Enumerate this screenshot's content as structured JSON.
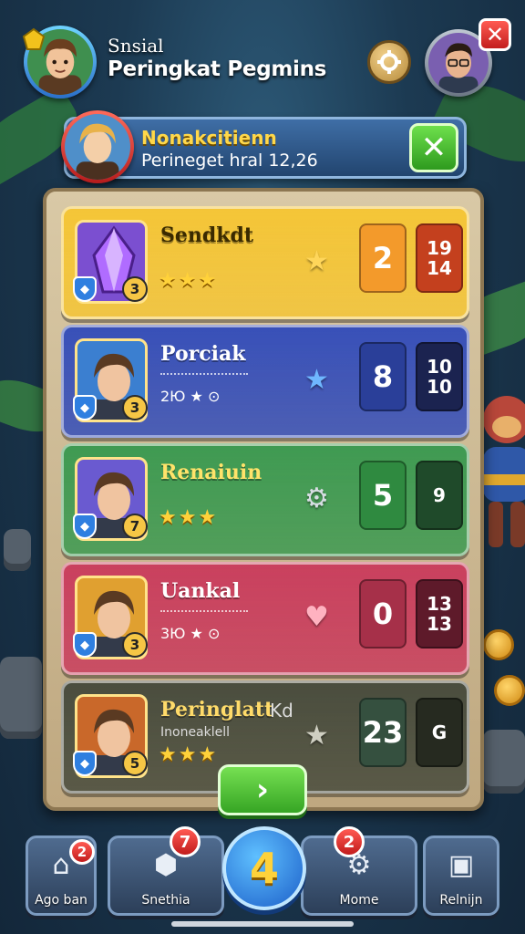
{
  "header": {
    "title_small": "Snsial",
    "title_big": "Peringkat Pegmins"
  },
  "player": {
    "name": "Nonakcitienn",
    "subtitle": "Perineget hral 12,26"
  },
  "rows": [
    {
      "name": "Sendkdt",
      "level": "3",
      "stars": "★★★",
      "score": "",
      "rank_a": "2",
      "rank_b": "19\n14",
      "mid_icon": "★",
      "colors": {
        "bg": "#f4c537",
        "name": "#3a2a00",
        "box_a": "#f39a2b",
        "box_b": "#c4401e",
        "mid": "#ffd65a"
      }
    },
    {
      "name": "Porciak",
      "level": "3",
      "stars": "",
      "score": "2Ю ★ ⊙",
      "rank_a": "8",
      "rank_b": "10\n10",
      "mid_icon": "★",
      "colors": {
        "bg": "#3850b8",
        "name": "#ffffff",
        "box_a": "#2a3f99",
        "box_b": "#1b2350",
        "mid": "#6fb7ff"
      }
    },
    {
      "name": "Renaiuin",
      "level": "7",
      "stars": "★★★",
      "score": "",
      "rank_a": "5",
      "rank_b": "9",
      "mid_icon": "⚙",
      "colors": {
        "bg": "#3f9a52",
        "name": "#ffe36a",
        "box_a": "#2f8a40",
        "box_b": "#1f4a2a",
        "mid": "#d7dde3"
      }
    },
    {
      "name": "Uankal",
      "level": "3",
      "stars": "",
      "score": "3Ю ★ ⊙",
      "rank_a": "0",
      "rank_b": "13\n13",
      "mid_icon": "♥",
      "colors": {
        "bg": "#c9405e",
        "name": "#ffffff",
        "box_a": "#a63049",
        "box_b": "#5e1a2a",
        "mid": "#ffb2c0"
      }
    },
    {
      "name": "Peringlatt",
      "level": "5",
      "stars": "★★★",
      "score": "",
      "rank_a": "23",
      "rank_b": "G",
      "mid_icon": "★",
      "colors": {
        "bg": "#4a4d3e",
        "name": "#ffdb6a",
        "box_a": "#35503f",
        "box_b": "#262a20",
        "mid": "#cfcfc2"
      },
      "extra": "Kd",
      "wave_text": "Inoneaklell"
    }
  ],
  "next_label": "›",
  "nav": {
    "left_label": "Ago ban",
    "left_badge": "2",
    "second_label": "Snethia",
    "second_badge": "7",
    "center_label": "4",
    "fourth_label": "Mome",
    "fourth_badge": "2",
    "right_label": "Relnijn"
  },
  "icons": {
    "gear": "gear-icon",
    "close": "close-icon",
    "home": "home-icon",
    "chevron": "chevron-right-icon"
  }
}
